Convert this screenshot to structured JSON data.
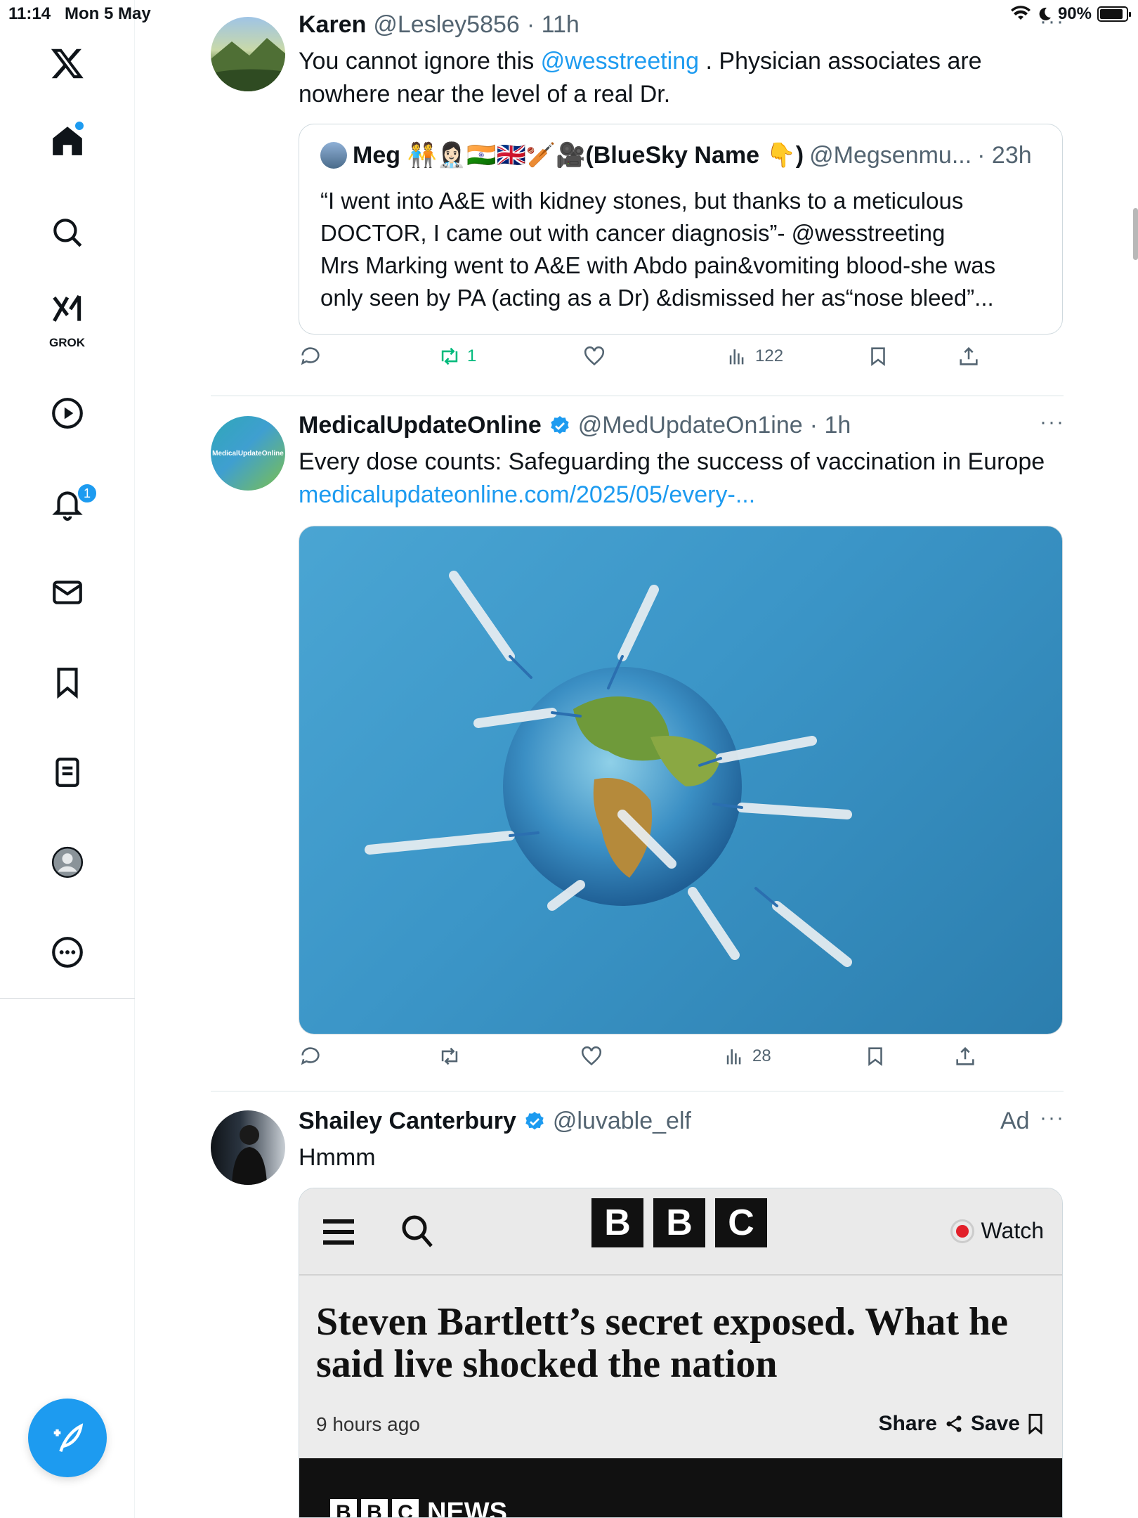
{
  "status_bar": {
    "time": "11:14",
    "date": "Mon 5 May",
    "battery": "90%",
    "battery_level": 0.9
  },
  "sidebar": {
    "items": [
      {
        "name": "x-logo",
        "icon": "x-logo-icon"
      },
      {
        "name": "home",
        "icon": "home-icon",
        "has_dot": true
      },
      {
        "name": "search",
        "icon": "search-icon"
      },
      {
        "name": "grok",
        "icon": "grok-icon",
        "label": "GROK"
      },
      {
        "name": "video",
        "icon": "play-icon"
      },
      {
        "name": "notifications",
        "icon": "bell-icon",
        "badge": "1"
      },
      {
        "name": "messages",
        "icon": "mail-icon"
      },
      {
        "name": "bookmarks",
        "icon": "bookmark-icon"
      },
      {
        "name": "lists",
        "icon": "list-icon"
      },
      {
        "name": "profile",
        "icon": "profile-icon"
      },
      {
        "name": "more",
        "icon": "more-circle-icon"
      }
    ],
    "compose_icon": "compose-feather-icon",
    "accent_color": "#1d9bf0"
  },
  "tweets": [
    {
      "author": "Karen",
      "handle": "@Lesley5856",
      "time": "· 11h",
      "text_before": "You cannot ignore this ",
      "mention": "@wesstreeting",
      "text_after": " . Physician associates are nowhere near the level of a real Dr.",
      "quote": {
        "author": "Meg 🧑‍🤝‍🧑👩🏻‍⚕️🇮🇳🇬🇧🏏🎥(BlueSky Name 👇)",
        "handle": "@Megsenmu...",
        "time": "· 23h",
        "text": "“I went into A&E with kidney stones, but thanks to a meticulous DOCTOR, I came out with cancer diagnosis”- @wesstreeting\nMrs Marking went to A&E with Abdo pain&vomiting blood-she was only seen by PA (acting as a Dr) &dismissed her as“nose bleed”..."
      },
      "actions": {
        "replies": "",
        "reposts": "1",
        "likes": "",
        "views": "122"
      }
    },
    {
      "author": "MedicalUpdateOnline",
      "handle": "@MedUpdateOn1ine",
      "time": "· 1h",
      "verified": true,
      "avatar_text": "MedicalUpdateOnline",
      "text": "Every dose counts: Safeguarding the success of vaccination in Europe",
      "link": "medicalupdateonline.com/2025/05/every-...",
      "actions": {
        "replies": "",
        "reposts": "",
        "likes": "",
        "views": "28"
      }
    },
    {
      "author": "Shailey Canterbury",
      "handle": "@luvable_elf",
      "verified": true,
      "ad_label": "Ad",
      "text": "Hmmm",
      "ad_card": {
        "logo_letters": [
          "B",
          "B",
          "C"
        ],
        "watch_label": "Watch",
        "headline": "Steven Bartlett’s secret exposed. What he said live shocked the nation",
        "time_ago": "9 hours ago",
        "share_label": "Share",
        "save_label": "Save",
        "news_letters": [
          "B",
          "B",
          "C"
        ],
        "news_label": "NEWS"
      }
    }
  ],
  "more_glyph": "···"
}
